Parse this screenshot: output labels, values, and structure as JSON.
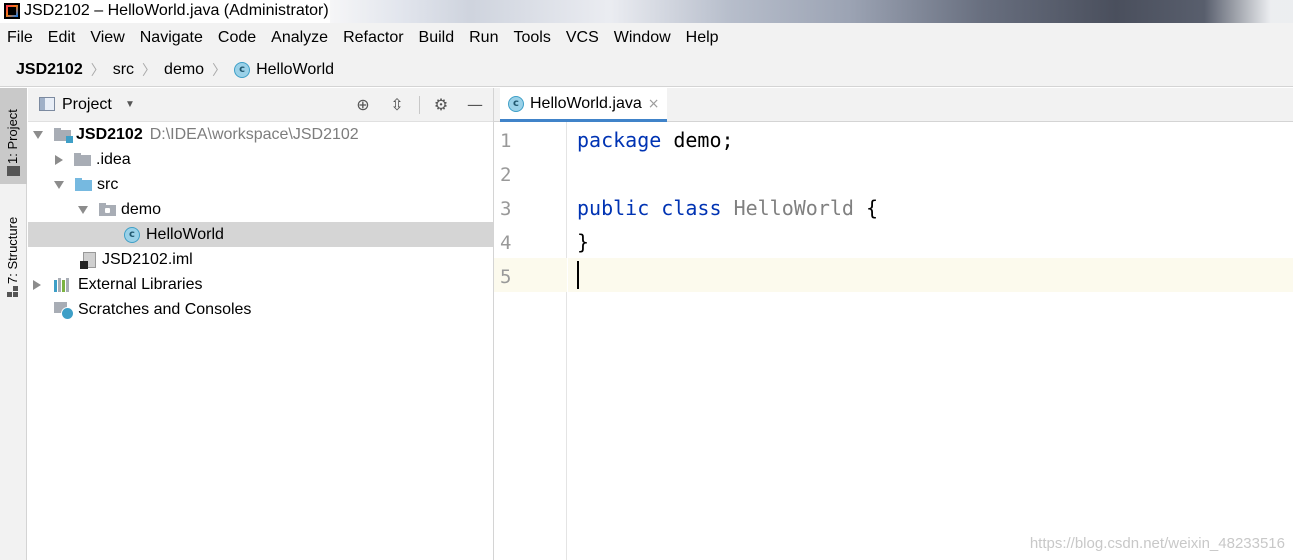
{
  "window": {
    "title": "JSD2102 – HelloWorld.java (Administrator)"
  },
  "menu": [
    "File",
    "Edit",
    "View",
    "Navigate",
    "Code",
    "Analyze",
    "Refactor",
    "Build",
    "Run",
    "Tools",
    "VCS",
    "Window",
    "Help"
  ],
  "breadcrumb": {
    "project": "JSD2102",
    "src": "src",
    "package": "demo",
    "class": "HelloWorld"
  },
  "toolstrip": {
    "project_tab": "1: Project",
    "structure_tab": "7: Structure"
  },
  "project_panel": {
    "title": "Project",
    "tree": {
      "root_name": "JSD2102",
      "root_path": "D:\\IDEA\\workspace\\JSD2102",
      "idea": ".idea",
      "src": "src",
      "demo": "demo",
      "helloworld": "HelloWorld",
      "iml": "JSD2102.iml",
      "external_libraries": "External Libraries",
      "scratches": "Scratches and Consoles"
    }
  },
  "editor": {
    "tab_label": "HelloWorld.java",
    "line_numbers": [
      "1",
      "2",
      "3",
      "4",
      "5"
    ],
    "code": {
      "line1_kw": "package",
      "line1_rest": " demo;",
      "line3_kw1": "public",
      "line3_kw2": "class",
      "line3_name": "HelloWorld",
      "line3_brace": " {",
      "line4": "}"
    }
  },
  "watermark": "https://blog.csdn.net/weixin_48233516",
  "colors": {
    "keyword": "#0033b3",
    "class_name": "#808080",
    "selection": "#d5d5d5",
    "current_line": "#fcfaed",
    "tab_underline": "#4083c9"
  }
}
